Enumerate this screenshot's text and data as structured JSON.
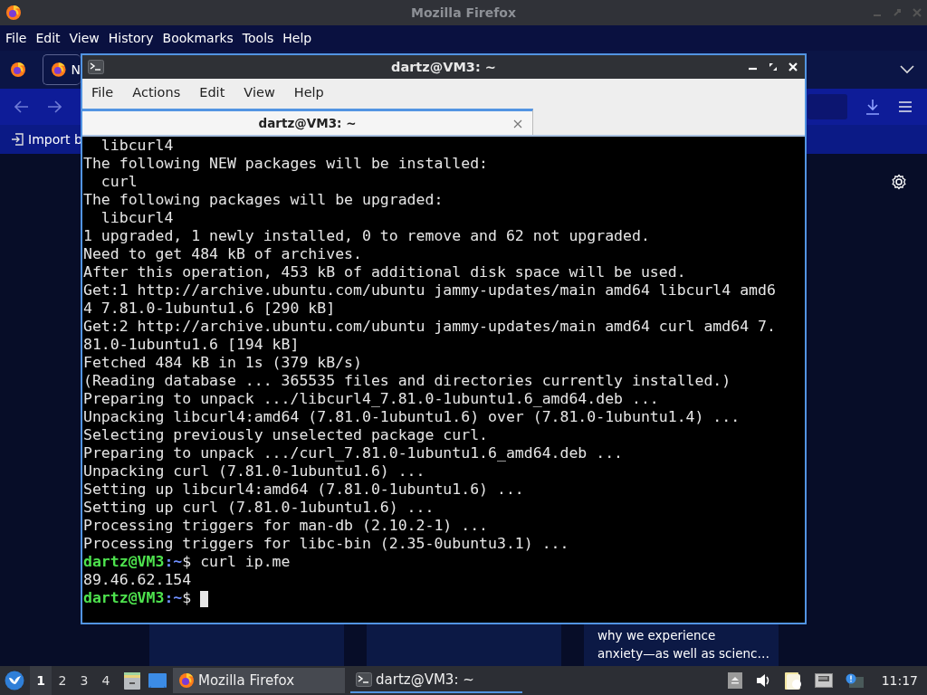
{
  "firefox": {
    "title": "Mozilla Firefox",
    "menu": [
      "File",
      "Edit",
      "View",
      "History",
      "Bookmarks",
      "Tools",
      "Help"
    ],
    "tab": {
      "label": "N"
    },
    "bookmark": "Import b",
    "card_text": [
      "why we experience",
      "anxiety—as well as scienc…"
    ]
  },
  "terminal": {
    "title": "dartz@VM3: ~",
    "menu": [
      "File",
      "Actions",
      "Edit",
      "View",
      "Help"
    ],
    "tabs": [
      {
        "label": "dartz@VM3: ~",
        "selected": true
      }
    ],
    "lines": [
      {
        "kind": "output",
        "text": "  libcurl4"
      },
      {
        "kind": "output",
        "text": "The following NEW packages will be installed:"
      },
      {
        "kind": "output",
        "text": "  curl"
      },
      {
        "kind": "output",
        "text": "The following packages will be upgraded:"
      },
      {
        "kind": "output",
        "text": "  libcurl4"
      },
      {
        "kind": "output",
        "text": "1 upgraded, 1 newly installed, 0 to remove and 62 not upgraded."
      },
      {
        "kind": "output",
        "text": "Need to get 484 kB of archives."
      },
      {
        "kind": "output",
        "text": "After this operation, 453 kB of additional disk space will be used."
      },
      {
        "kind": "output",
        "text": "Get:1 http://archive.ubuntu.com/ubuntu jammy-updates/main amd64 libcurl4 amd6"
      },
      {
        "kind": "output",
        "text": "4 7.81.0-1ubuntu1.6 [290 kB]"
      },
      {
        "kind": "output",
        "text": "Get:2 http://archive.ubuntu.com/ubuntu jammy-updates/main amd64 curl amd64 7."
      },
      {
        "kind": "output",
        "text": "81.0-1ubuntu1.6 [194 kB]"
      },
      {
        "kind": "output",
        "text": "Fetched 484 kB in 1s (379 kB/s)"
      },
      {
        "kind": "output",
        "text": "(Reading database ... 365535 files and directories currently installed.)"
      },
      {
        "kind": "output",
        "text": "Preparing to unpack .../libcurl4_7.81.0-1ubuntu1.6_amd64.deb ..."
      },
      {
        "kind": "output",
        "text": "Unpacking libcurl4:amd64 (7.81.0-1ubuntu1.6) over (7.81.0-1ubuntu1.4) ..."
      },
      {
        "kind": "output",
        "text": "Selecting previously unselected package curl."
      },
      {
        "kind": "output",
        "text": "Preparing to unpack .../curl_7.81.0-1ubuntu1.6_amd64.deb ..."
      },
      {
        "kind": "output",
        "text": "Unpacking curl (7.81.0-1ubuntu1.6) ..."
      },
      {
        "kind": "output",
        "text": "Setting up libcurl4:amd64 (7.81.0-1ubuntu1.6) ..."
      },
      {
        "kind": "output",
        "text": "Setting up curl (7.81.0-1ubuntu1.6) ..."
      },
      {
        "kind": "output",
        "text": "Processing triggers for man-db (2.10.2-1) ..."
      },
      {
        "kind": "output",
        "text": "Processing triggers for libc-bin (2.35-0ubuntu3.1) ..."
      },
      {
        "kind": "prompt",
        "user": "dartz@VM3",
        "path": ":~",
        "command": "$ curl ip.me",
        "cursor": false
      },
      {
        "kind": "output",
        "text": "89.46.62.154"
      },
      {
        "kind": "prompt",
        "user": "dartz@VM3",
        "path": ":~",
        "command": "$ ",
        "cursor": true
      }
    ]
  },
  "taskbar": {
    "workspaces": [
      {
        "label": "1",
        "selected": true
      },
      {
        "label": "2",
        "selected": false
      },
      {
        "label": "3",
        "selected": false
      },
      {
        "label": "4",
        "selected": false
      }
    ],
    "tasks": [
      {
        "label": "Mozilla Firefox",
        "kind": "firefox",
        "selected": false
      },
      {
        "label": "dartz@VM3: ~",
        "kind": "terminal",
        "selected": true
      }
    ],
    "clock": "11:17"
  }
}
